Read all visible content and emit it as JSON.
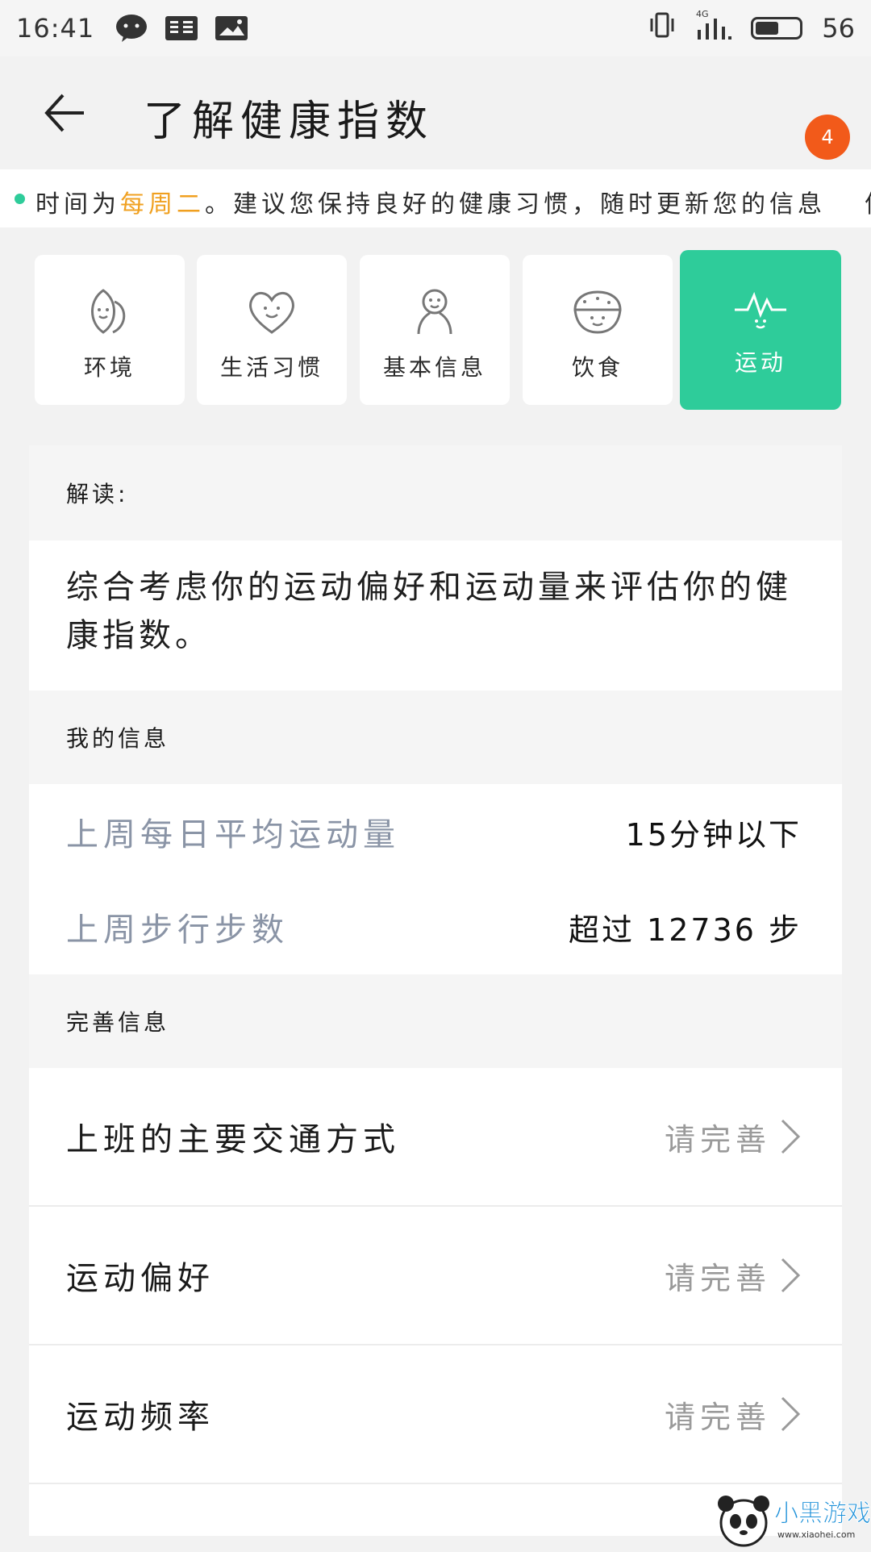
{
  "status_bar": {
    "time": "16:41",
    "battery_level": "56",
    "network": "4G"
  },
  "app_bar": {
    "title": "了解健康指数",
    "badge_count": "4"
  },
  "ticker": {
    "prefix": "时间为",
    "highlight": "每周二",
    "suffix": "。建议您保持良好的健康习惯，随时更新您的信息",
    "tail": "信"
  },
  "categories": [
    {
      "label": "环境",
      "icon": "leaf-face-icon",
      "active": false
    },
    {
      "label": "生活习惯",
      "icon": "heart-face-icon",
      "active": false
    },
    {
      "label": "基本信息",
      "icon": "person-icon",
      "active": false
    },
    {
      "label": "饮食",
      "icon": "bowl-face-icon",
      "active": false
    },
    {
      "label": "运动",
      "icon": "pulse-face-icon",
      "active": true
    }
  ],
  "interpretation": {
    "heading": "解读:",
    "text": "综合考虑你的运动偏好和运动量来评估你的健康指数。"
  },
  "my_info": {
    "heading": "我的信息",
    "rows": [
      {
        "label": "上周每日平均运动量",
        "value": "15分钟以下"
      },
      {
        "label": "上周步行步数",
        "value": "超过 12736 步"
      }
    ]
  },
  "complete_info": {
    "heading": "完善信息",
    "rows": [
      {
        "label": "上班的主要交通方式",
        "action": "请完善"
      },
      {
        "label": "运动偏好",
        "action": "请完善"
      },
      {
        "label": "运动频率",
        "action": "请完善"
      }
    ]
  },
  "watermark": {
    "brand": "小黑游戏",
    "url": "www.xiaohei.com"
  },
  "colors": {
    "accent": "#2ecc9a",
    "badge": "#f25a1a",
    "highlight": "#f0a020",
    "muted_label": "#8a94a6"
  }
}
